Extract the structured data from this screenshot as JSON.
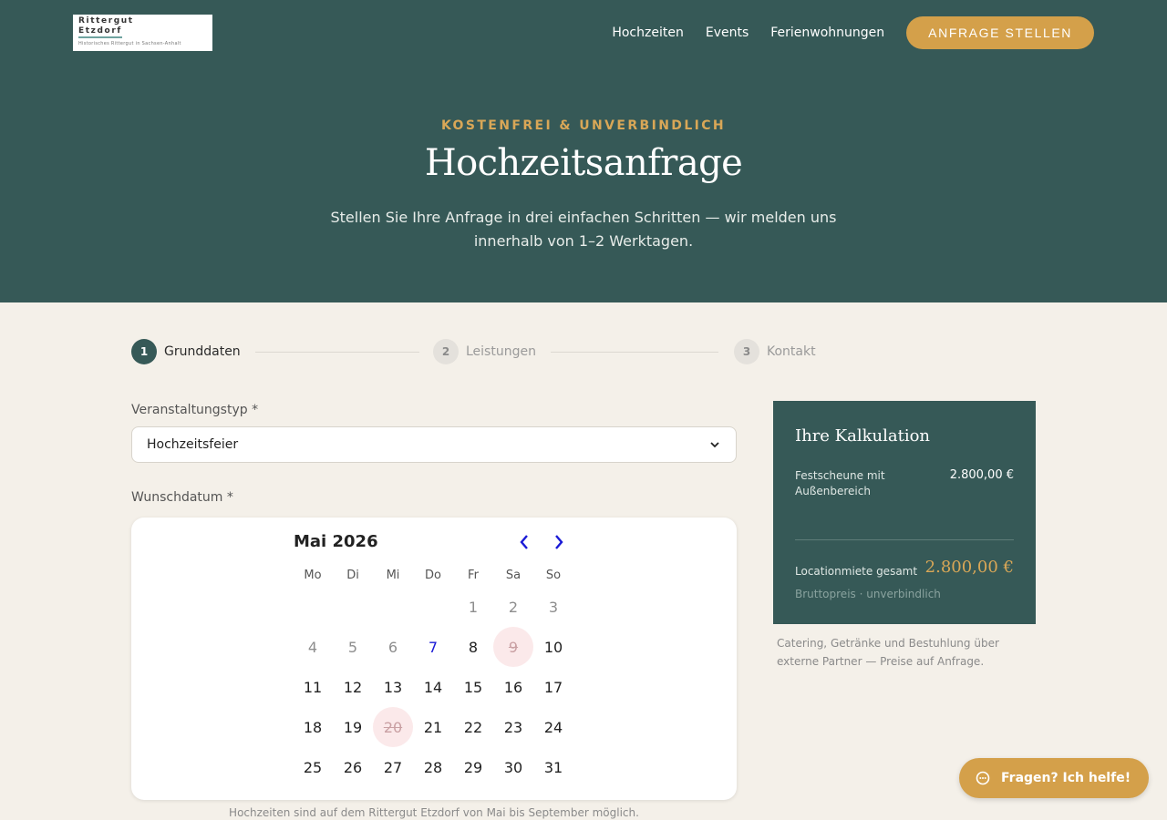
{
  "header": {
    "logo": {
      "line1": "Rittergut",
      "line2": "Etzdorf",
      "tagline": "Historisches Rittergut in Sachsen-Anhalt"
    },
    "nav": [
      "Hochzeiten",
      "Events",
      "Ferienwohnungen"
    ],
    "cta": "ANFRAGE STELLEN"
  },
  "hero": {
    "eyebrow": "KOSTENFREI & UNVERBINDLICH",
    "title": "Hochzeitsanfrage",
    "subtitle_line1": "Stellen Sie Ihre Anfrage in drei einfachen Schritten — wir melden uns",
    "subtitle_line2": "innerhalb von 1–2 Werktagen."
  },
  "stepper": [
    {
      "num": "1",
      "label": "Grunddaten",
      "state": "active"
    },
    {
      "num": "2",
      "label": "Leistungen",
      "state": "inactive"
    },
    {
      "num": "3",
      "label": "Kontakt",
      "state": "inactive"
    }
  ],
  "form": {
    "event_type": {
      "label": "Veranstaltungstyp *",
      "value": "Hochzeitsfeier"
    },
    "date": {
      "label": "Wunschdatum *"
    }
  },
  "calendar": {
    "month_label": "Mai 2026",
    "weekdays": [
      "Mo",
      "Di",
      "Mi",
      "Do",
      "Fr",
      "Sa",
      "So"
    ],
    "first_weekday_index": 4,
    "days_in_month": 31,
    "past_days": [
      1,
      2,
      3,
      4,
      5,
      6
    ],
    "today": 7,
    "blocked_days": [
      9,
      20
    ],
    "note": "Hochzeiten sind auf dem Rittergut Etzdorf von Mai bis September möglich."
  },
  "calculation": {
    "title": "Ihre Kalkulation",
    "item_name": "Festscheune mit Außenbereich",
    "item_price": "2.800,00 €",
    "total_label": "Locationmiete gesamt",
    "total_value": "2.800,00 €",
    "total_note": "Bruttopreis · unverbindlich",
    "footnote": "Catering, Getränke und Bestuhlung über externe Partner — Preise auf Anfrage."
  },
  "help": {
    "label": "Fragen? Ich helfe!"
  },
  "colors": {
    "primary": "#365957",
    "accent": "#d4a04a",
    "background": "#f4f0e9",
    "blocked_day": "#fbe9ea"
  },
  "icons": {
    "select_chevron": "chevron-down-icon",
    "prev_month": "chevron-left-icon",
    "next_month": "chevron-right-icon",
    "help": "chat-bubble-icon"
  }
}
